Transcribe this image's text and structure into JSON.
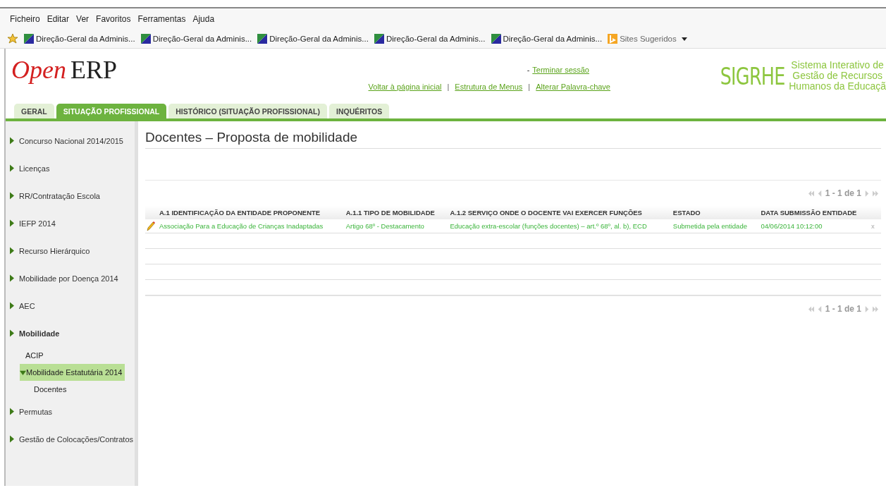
{
  "menu_bar": [
    "Ficheiro",
    "Editar",
    "Ver",
    "Favoritos",
    "Ferramentas",
    "Ajuda"
  ],
  "favorites": {
    "items": [
      "Direção-Geral da Adminis...",
      "Direção-Geral da Adminis...",
      "Direção-Geral da Adminis...",
      "Direção-Geral da Adminis...",
      "Direção-Geral da Adminis..."
    ],
    "suggested": "Sites Sugeridos"
  },
  "header": {
    "logo_first": "Open",
    "logo_second": "ERP",
    "logout_separator": "-",
    "logout": "Terminar sessão",
    "links": [
      "Voltar à página inicial",
      "Estrutura de Menus",
      "Alterar Palavra-chave"
    ],
    "link_separator": "|",
    "brand": "SIGRHE",
    "brand_tagline": [
      "Sistema Interativo de",
      "Gestão de Recursos",
      "Humanos da Educaçã"
    ]
  },
  "tabs": [
    {
      "label": "GERAL",
      "selected": false
    },
    {
      "label": "SITUAÇÃO PROFISSIONAL",
      "selected": true
    },
    {
      "label": "HISTÓRICO (SITUAÇÃO PROFISSIONAL)",
      "selected": false
    },
    {
      "label": "INQUÉRITOS",
      "selected": false
    }
  ],
  "sidebar": {
    "items": [
      {
        "label": "Concurso Nacional 2014/2015",
        "selected": false
      },
      {
        "label": "Licenças",
        "selected": false
      },
      {
        "label": "RR/Contratação Escola",
        "selected": false
      },
      {
        "label": "IEFP 2014",
        "selected": false
      },
      {
        "label": "Recurso Hierárquico",
        "selected": false
      },
      {
        "label": "Mobilidade por Doença 2014",
        "selected": false
      },
      {
        "label": "AEC",
        "selected": false
      },
      {
        "label": "Mobilidade",
        "selected": true,
        "children": [
          {
            "label": "ACIP",
            "selected": false
          },
          {
            "label": "Mobilidade Estatutária 2014",
            "selected": true,
            "expanded": true,
            "children": [
              {
                "label": "Docentes",
                "selected": false
              }
            ]
          }
        ]
      },
      {
        "label": "Permutas",
        "selected": false
      },
      {
        "label": "Gestão de Colocações/Contratos",
        "selected": false
      }
    ]
  },
  "page_title": "Docentes – Proposta de mobilidade",
  "pager_top": "1 - 1 de 1",
  "table": {
    "columns": [
      "A.1 IDENTIFICAÇÃO DA ENTIDADE PROPONENTE",
      "A.1.1 TIPO DE MOBILIDADE",
      "A.1.2 SERVIÇO ONDE O DOCENTE VAI EXERCER FUNÇÕES",
      "ESTADO",
      "DATA SUBMISSÃO ENTIDADE"
    ],
    "rows": [
      {
        "cells": [
          "Associação Para a Educação de Crianças Inadaptadas",
          "Artigo 68º - Destacamento",
          "Educação extra-escolar (funções docentes) – art.º 68º, al. b), ECD",
          "Submetida pela entidade",
          "04/06/2014 10:12:00"
        ],
        "delete": "x"
      }
    ]
  },
  "pager_bottom": "1 - 1 de 1"
}
